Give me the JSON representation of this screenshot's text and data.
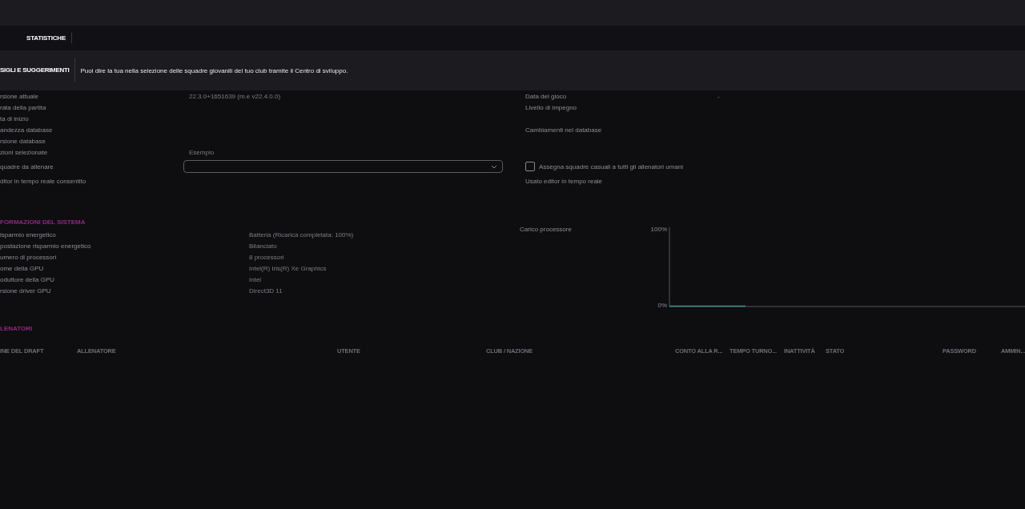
{
  "nav": {
    "tabs": [
      {
        "label": "STATISTICHE",
        "selected": true
      }
    ]
  },
  "tips": {
    "title": "SIGLI E SUGGERIMENTI",
    "text": "Puoi dire la tua nella selezione delle squadre giovanili del tuo club tramite il Centro di sviluppo."
  },
  "game_info": {
    "rows": [
      {
        "kind": "text",
        "label": "rsione attuale",
        "value": "22.3.0+1651639 (m.e v22.4.0.0)",
        "right_label": "Data del gioco",
        "right_value": "-"
      },
      {
        "kind": "text",
        "label": "rata della partita",
        "right_label": "Livello di impegno"
      },
      {
        "kind": "text",
        "label": "ta di inizio"
      },
      {
        "kind": "text",
        "label": "andezza database",
        "right_label": "Cambiamenti nel database"
      },
      {
        "kind": "text",
        "label": "rsione database"
      },
      {
        "kind": "text",
        "label": "zioni selezionate",
        "value": "Esempio"
      },
      {
        "kind": "dropdown",
        "label": "quadre da allenare",
        "checkbox": {
          "label": "Assegna squadre casuali a tutti gli allenatori umani",
          "checked": false
        }
      },
      {
        "kind": "text",
        "label": "ditor in tempo reale consentito",
        "right_label": "Usato editor in tempo reale"
      }
    ]
  },
  "system_info": {
    "title": "FORMAZIONI DEL SISTEMA",
    "rows": [
      {
        "label": "isparmio energetico",
        "value": "Batteria (Ricarica completata: 100%)"
      },
      {
        "label": "postazione risparmio energetico",
        "value": "Bilanciato"
      },
      {
        "label": "umero di processori",
        "value": "8 processori"
      },
      {
        "label": "ome della GPU",
        "value": "Intel(R) Iris(R) Xe Graphics"
      },
      {
        "label": "oduttore della GPU",
        "value": "Intel"
      },
      {
        "label": "rsione driver GPU",
        "value": "Direct3D 11"
      }
    ],
    "cpu_load": {
      "label": "Carico processore",
      "top_label": "100%",
      "bottom_label": "0%"
    }
  },
  "coaches": {
    "title": "LENATORI",
    "columns": [
      "INE DEL DRAFT",
      "ALLENATORE",
      "UTENTE",
      "CLUB / NAZIONE",
      "CONTO ALLA R...",
      "TEMPO TURNO...",
      "INATTIVITÀ",
      "STATO",
      "PASSWORD",
      "AMMIN..."
    ]
  }
}
